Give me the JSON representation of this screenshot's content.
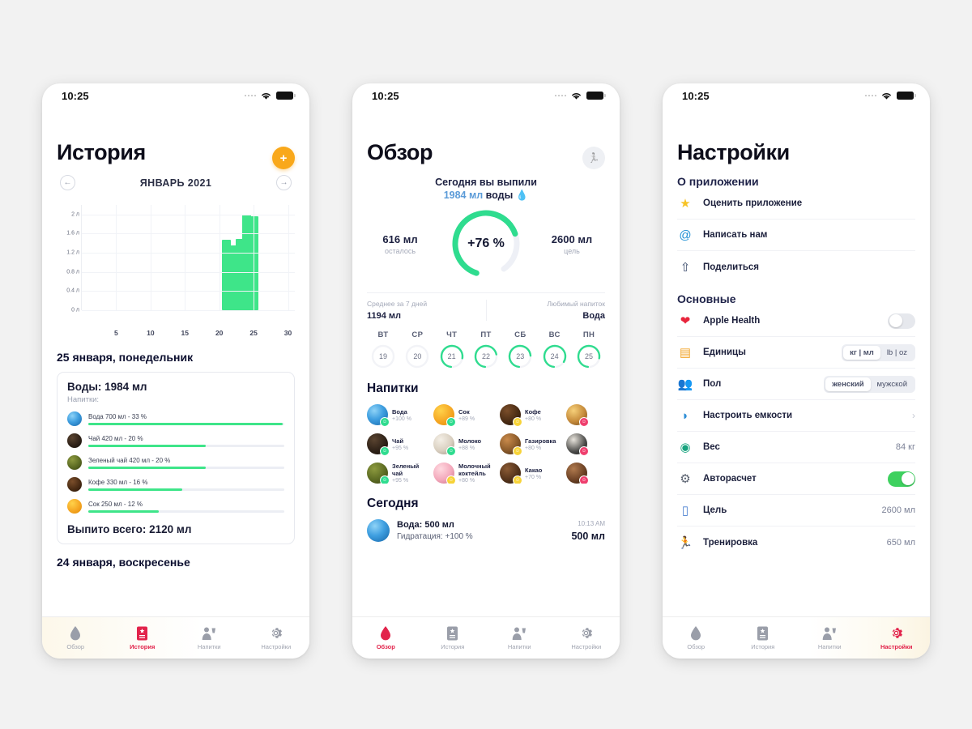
{
  "statusbar": {
    "time": "10:25"
  },
  "phone1": {
    "title": "История",
    "add_button": "+",
    "month": "ЯНВАРЬ 2021",
    "prev_icon": "arrow-left-icon",
    "next_icon": "arrow-right-icon",
    "chart_data": {
      "type": "bar",
      "title": "ЯНВАРЬ 2021",
      "xlabel": "",
      "ylabel": "л",
      "categories": [
        21,
        22,
        23,
        24,
        25
      ],
      "values": [
        1.48,
        1.36,
        1.49,
        1.99,
        1.97
      ],
      "x_ticks": [
        5,
        10,
        15,
        20,
        25,
        30
      ],
      "y_ticks": [
        "0 л",
        "0.4 л",
        "0.8 л",
        "1.2 л",
        "1.6 л",
        "2 л"
      ],
      "ylim": [
        0,
        2.2
      ],
      "xlim": [
        0,
        31
      ],
      "grid": true,
      "bar_color": "#3ee589"
    },
    "day_title": "25 января, понедельник",
    "card": {
      "heading": "Воды: 1984 мл",
      "sub": "Напитки:",
      "drinks": [
        {
          "label": "Вода 700 мл - 33 %",
          "percent": 33,
          "icon": "water-drop-icon"
        },
        {
          "label": "Чай 420 мл - 20 %",
          "percent": 20,
          "icon": "tea-icon"
        },
        {
          "label": "Зеленый чай 420 мл - 20 %",
          "percent": 20,
          "icon": "green-tea-icon"
        },
        {
          "label": "Кофе 330 мл - 16 %",
          "percent": 16,
          "icon": "coffee-icon"
        },
        {
          "label": "Сок 250 мл - 12 %",
          "percent": 12,
          "icon": "juice-icon"
        }
      ],
      "total": "Выпито всего: 2120 мл"
    },
    "day_title_2": "24 января, воскресенье",
    "tabs": [
      {
        "label": "Обзор",
        "icon": "water-drop-icon",
        "active": false
      },
      {
        "label": "История",
        "icon": "history-book-icon",
        "active": true
      },
      {
        "label": "Напитки",
        "icon": "person-drinking-icon",
        "active": false
      },
      {
        "label": "Настройки",
        "icon": "gear-icon",
        "active": false
      }
    ]
  },
  "phone2": {
    "title": "Обзор",
    "workout_button_icon": "runner-icon",
    "today_label": "Сегодня вы выпили",
    "today_amount": "1984 мл",
    "today_suffix": "воды",
    "today_drop_icon": "water-drop-icon",
    "left_stat": {
      "value": "616 мл",
      "key": "осталось"
    },
    "right_stat": {
      "value": "2600 мл",
      "key": "цель"
    },
    "ring_percent_label": "+76 %",
    "ring_percent": 76,
    "avg_key": "Среднее за 7 дней",
    "avg_value": "1194 мл",
    "fav_key": "Любимый напиток",
    "fav_value": "Вода",
    "week": [
      {
        "day": "ВТ",
        "num": "19",
        "percent": 0
      },
      {
        "day": "СР",
        "num": "20",
        "percent": 0
      },
      {
        "day": "ЧТ",
        "num": "21",
        "percent": 76
      },
      {
        "day": "ПТ",
        "num": "22",
        "percent": 70
      },
      {
        "day": "СБ",
        "num": "23",
        "percent": 72
      },
      {
        "day": "ВС",
        "num": "24",
        "percent": 82
      },
      {
        "day": "ПН",
        "num": "25",
        "percent": 76
      }
    ],
    "drinks_heading": "Напитки",
    "drinks": [
      {
        "name": "Вода",
        "pct": "+100 %",
        "blob": "blob-water",
        "badge": "green",
        "icon": "water-icon"
      },
      {
        "name": "Сок",
        "pct": "+89 %",
        "blob": "blob-juice",
        "badge": "green",
        "icon": "juice-icon"
      },
      {
        "name": "Кофе",
        "pct": "+80 %",
        "blob": "blob-coffee",
        "badge": "yellow",
        "icon": "coffee-icon"
      },
      {
        "name": "",
        "pct": "",
        "blob": "blob-beer",
        "badge": "red",
        "icon": "beer-icon"
      },
      {
        "name": "Чай",
        "pct": "+95 %",
        "blob": "blob-tea",
        "badge": "green",
        "icon": "tea-icon"
      },
      {
        "name": "Молоко",
        "pct": "+88 %",
        "blob": "blob-milk",
        "badge": "green",
        "icon": "milk-icon"
      },
      {
        "name": "Газировка",
        "pct": "+80 %",
        "blob": "blob-soda",
        "badge": "yellow",
        "icon": "soda-icon"
      },
      {
        "name": "",
        "pct": "",
        "blob": "blob-cock",
        "badge": "red",
        "icon": "cocktail-icon"
      },
      {
        "name": "Зеленый чай",
        "pct": "+95 %",
        "blob": "blob-green",
        "badge": "green",
        "icon": "green-tea-icon"
      },
      {
        "name": "Молочный коктейль",
        "pct": "+80 %",
        "blob": "blob-shake",
        "badge": "yellow",
        "icon": "milkshake-icon"
      },
      {
        "name": "Какао",
        "pct": "+70 %",
        "blob": "blob-cocoa",
        "badge": "yellow",
        "icon": "cocoa-icon"
      },
      {
        "name": "",
        "pct": "",
        "blob": "blob-wine",
        "badge": "red",
        "icon": "wine-icon"
      }
    ],
    "today_heading": "Сегодня",
    "today_item": {
      "title": "Вода: 500 мл",
      "sub": "Гидратация: +100 %",
      "time": "10:13 AM",
      "amount": "500 мл",
      "icon": "water-icon"
    },
    "tabs": [
      {
        "label": "Обзор",
        "icon": "water-drop-icon",
        "active": true
      },
      {
        "label": "История",
        "icon": "history-book-icon",
        "active": false
      },
      {
        "label": "Напитки",
        "icon": "person-drinking-icon",
        "active": false
      },
      {
        "label": "Настройки",
        "icon": "gear-icon",
        "active": false
      }
    ]
  },
  "phone3": {
    "title": "Настройки",
    "group_about": "О приложении",
    "about_rows": [
      {
        "label": "Оценить приложение",
        "icon": "star-icon",
        "glyph": "★",
        "color": "#f7c325"
      },
      {
        "label": "Написать нам",
        "icon": "at-sign-icon",
        "glyph": "@",
        "color": "#1e8fd4"
      },
      {
        "label": "Поделиться",
        "icon": "share-icon",
        "glyph": "⇧",
        "color": "#3a4a6b"
      }
    ],
    "group_main": "Основные",
    "main_rows": [
      {
        "label": "Apple Health",
        "icon": "heart-icon",
        "glyph": "❤",
        "color": "#e8253c",
        "control": "toggle",
        "state": "off"
      },
      {
        "label": "Единицы",
        "icon": "ruler-icon",
        "glyph": "▤",
        "color": "#f2a429",
        "control": "segment",
        "options": [
          "кг | мл",
          "lb | oz"
        ],
        "selected": 0
      },
      {
        "label": "Пол",
        "icon": "people-icon",
        "glyph": "👥",
        "color": "#3f8ad0",
        "control": "segment",
        "options": [
          "женский",
          "мужской"
        ],
        "selected": 0
      },
      {
        "label": "Настроить емкости",
        "icon": "bottle-icon",
        "glyph": "◗",
        "color": "#2f8ed6",
        "control": "chevron",
        "chevron": "›"
      },
      {
        "label": "Вес",
        "icon": "scale-icon",
        "glyph": "◉",
        "color": "#18a37e",
        "control": "value",
        "value": "84 кг"
      },
      {
        "label": "Авторасчет",
        "icon": "gear-icon",
        "glyph": "⚙",
        "color": "#5a6270",
        "control": "toggle",
        "state": "on"
      },
      {
        "label": "Цель",
        "icon": "measure-icon",
        "glyph": "▯",
        "color": "#4a7fd0",
        "control": "value",
        "value": "2600 мл"
      },
      {
        "label": "Тренировка",
        "icon": "runner-icon",
        "glyph": "🏃",
        "color": "#e8a33c",
        "control": "value",
        "value": "650 мл"
      }
    ],
    "tabs": [
      {
        "label": "Обзор",
        "icon": "water-drop-icon",
        "active": false
      },
      {
        "label": "История",
        "icon": "history-book-icon",
        "active": false
      },
      {
        "label": "Напитки",
        "icon": "person-drinking-icon",
        "active": false
      },
      {
        "label": "Настройки",
        "icon": "gear-icon",
        "active": true
      }
    ]
  },
  "colors": {
    "accent_green": "#3ee589",
    "accent_red": "#e2234b",
    "accent_orange": "#f9a81a",
    "text_dark": "#0d1030",
    "text_muted": "#a3a8b8"
  }
}
